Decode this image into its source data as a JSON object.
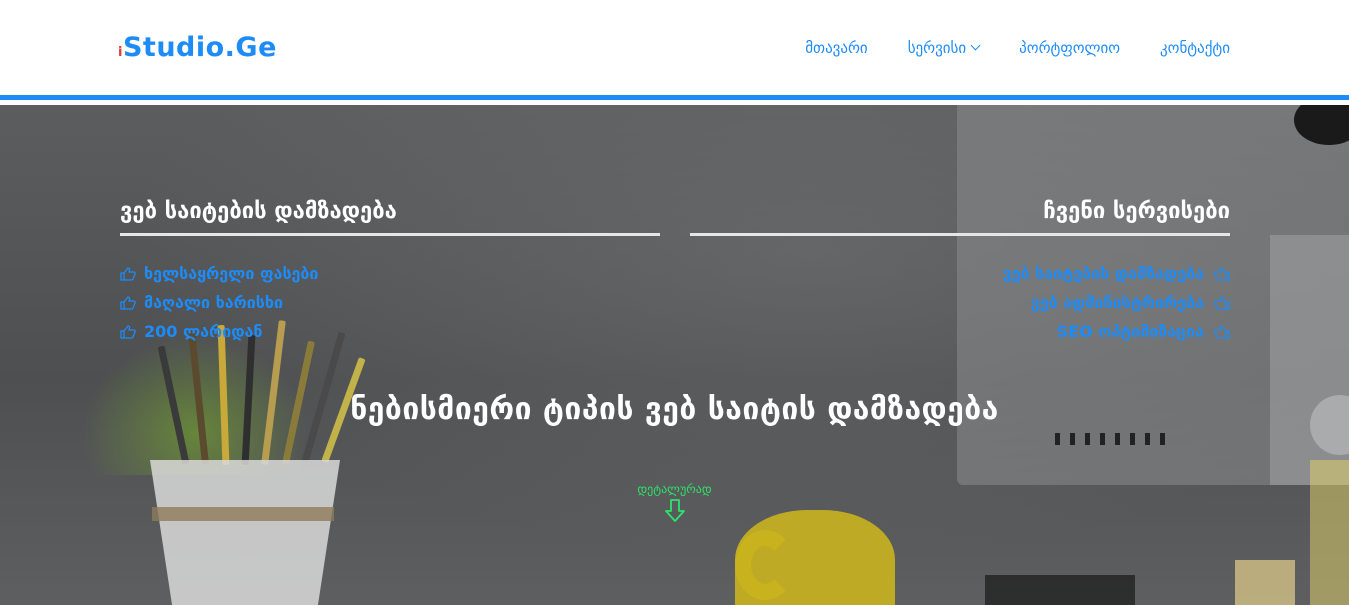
{
  "navbar": {
    "logo_prefix": "i",
    "logo_text": "Studio.Ge",
    "links": [
      {
        "label": "მთავარი"
      },
      {
        "label": "სერვისი"
      },
      {
        "label": "პორტფოლიო"
      },
      {
        "label": "კონტაქტი"
      }
    ]
  },
  "hero": {
    "left": {
      "title": "ვებ საიტების დამზადება",
      "items": [
        "ხელსაყრელი ფასები",
        "მაღალი ხარისხი",
        "200 ლარიდან"
      ]
    },
    "right": {
      "title": "ჩვენი სერვისები",
      "items": [
        "ვებ საიტების დამზადება",
        "ვებ ადმინისტრირება",
        "SEO ოპტიმიზაცია"
      ]
    },
    "headline": "ნებისმიერი ტიპის ვებ საიტის დამზადება",
    "details_link": "დეტალურად"
  },
  "colors": {
    "accent": "#1d8cf8",
    "logo_i": "#e53935",
    "details": "#2ee36a"
  },
  "icons": {
    "list_bullet": "thumbs-up-hand-icon",
    "details": "arrow-down-icon",
    "dropdown": "chevron-down-icon"
  }
}
